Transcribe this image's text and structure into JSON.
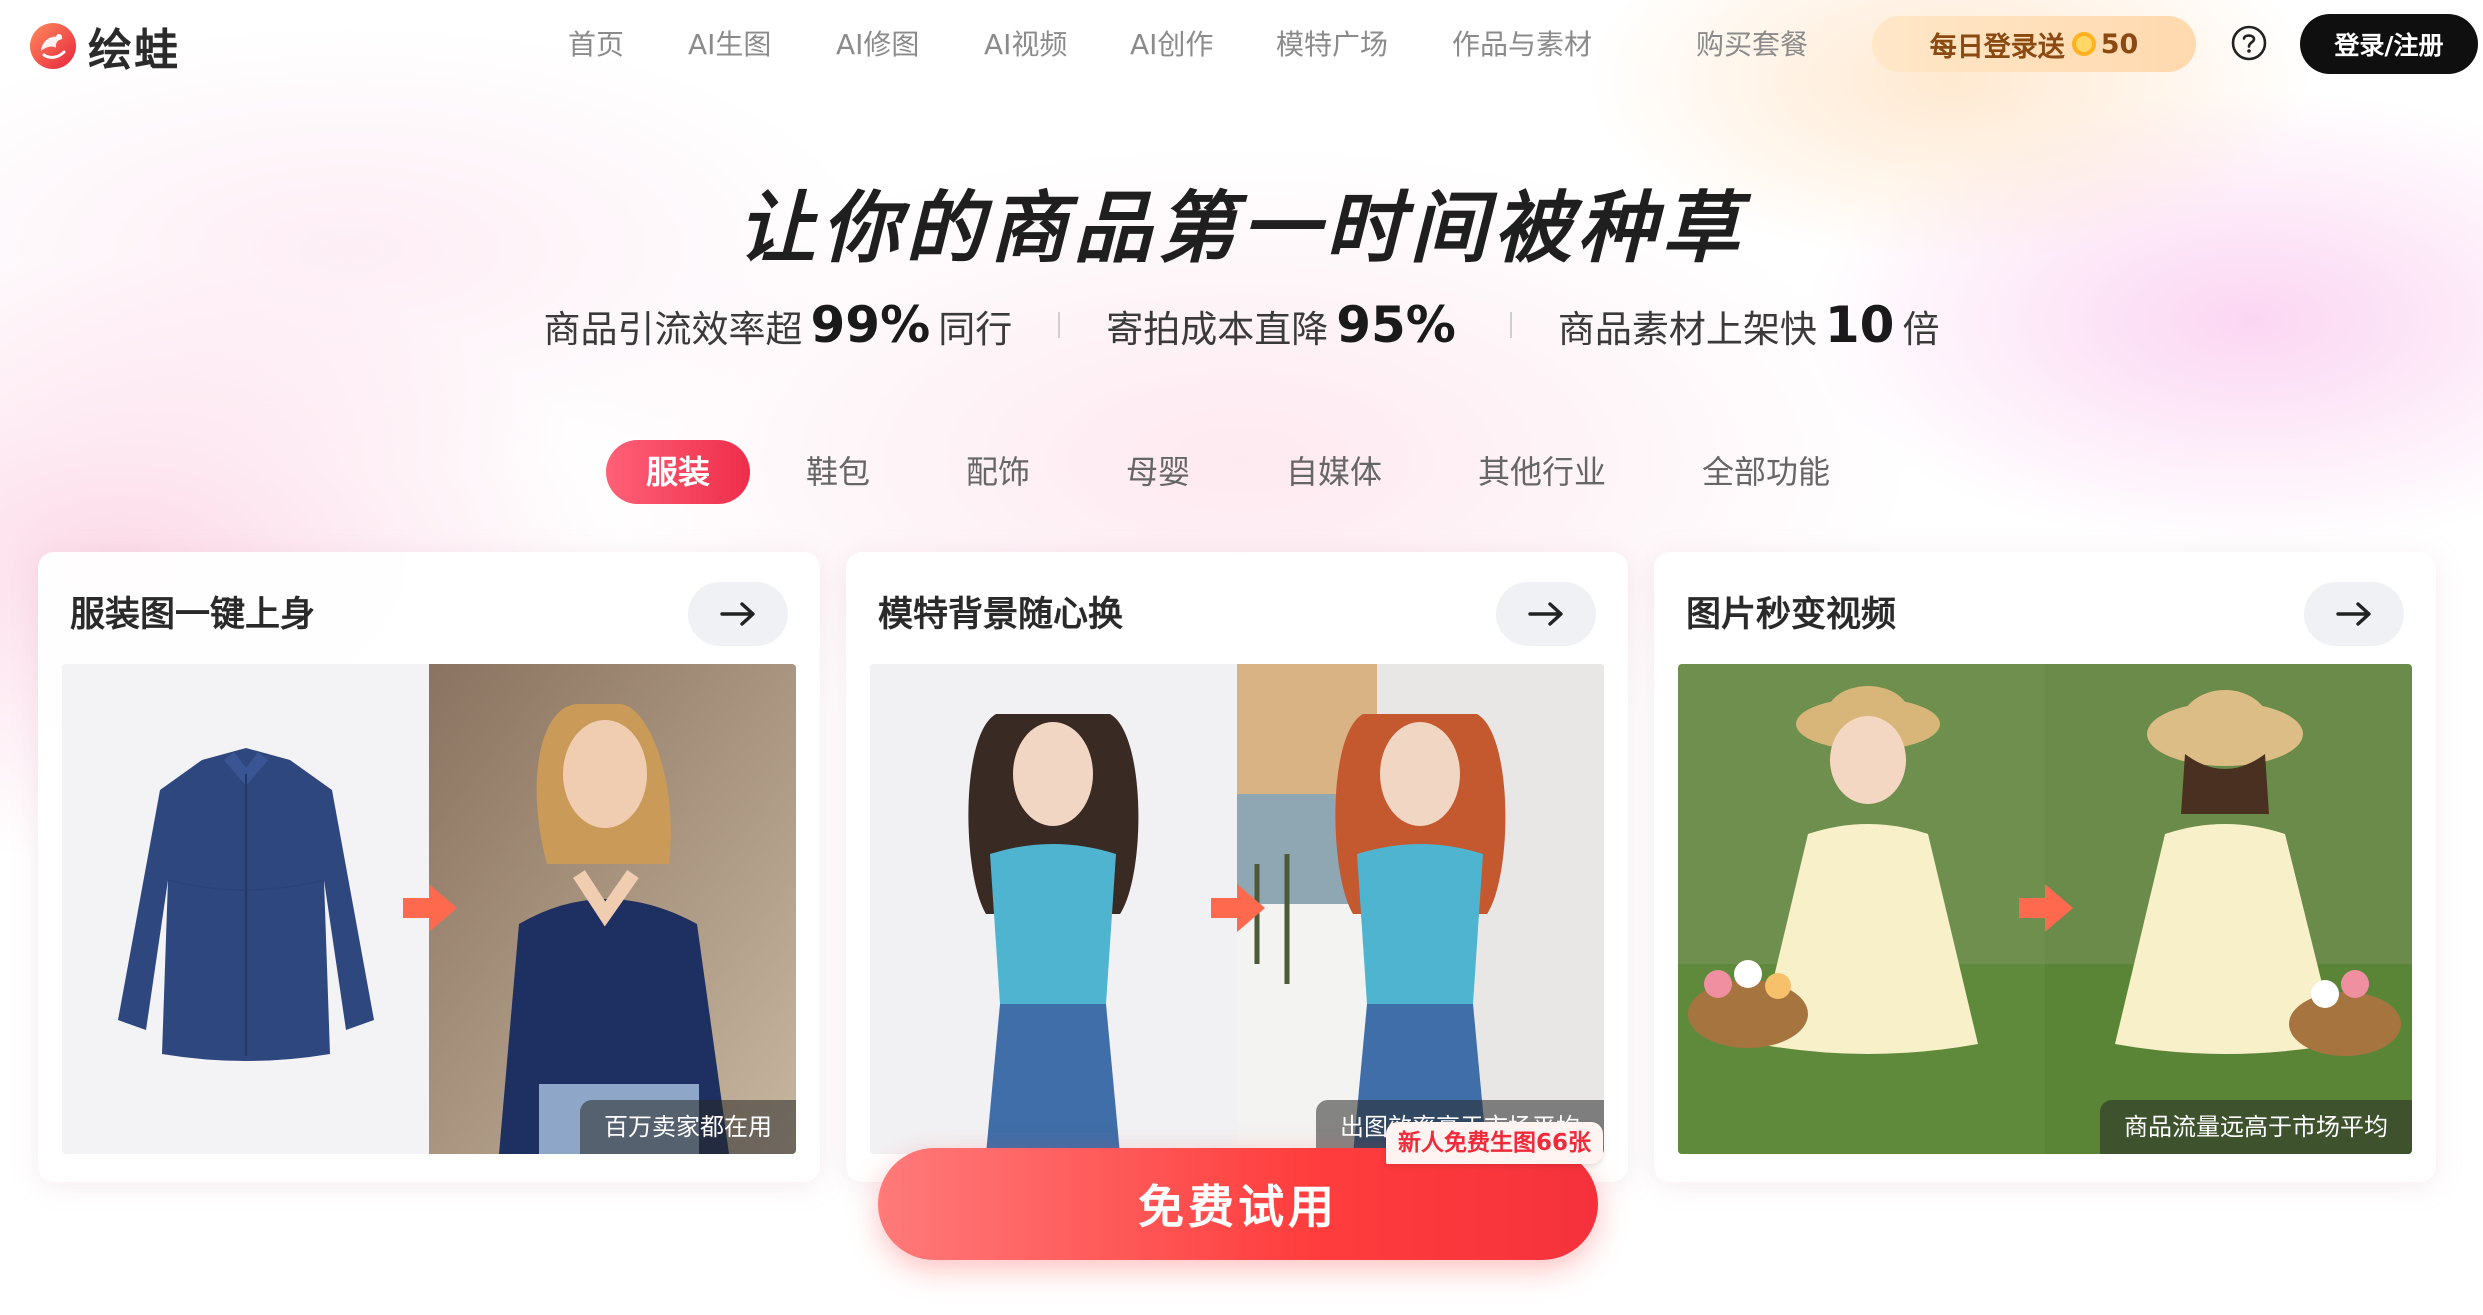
{
  "brand": {
    "name": "绘蛙",
    "logo_icon": "frog-logo-icon",
    "accent": "#ee2e4a"
  },
  "nav": {
    "items": [
      {
        "label": "首页"
      },
      {
        "label": "AI生图"
      },
      {
        "label": "AI修图"
      },
      {
        "label": "AI视频"
      },
      {
        "label": "AI创作"
      },
      {
        "label": "模特广场"
      },
      {
        "label": "作品与素材"
      },
      {
        "label": "购买套餐"
      }
    ],
    "promo": {
      "label": "每日登录送",
      "coin_icon": "coin-icon",
      "amount": "50"
    },
    "help_icon": "question-mark-icon",
    "login_label": "登录/注册"
  },
  "hero": {
    "title": "让你的商品第一时间被种草",
    "stats": [
      {
        "prefix": "商品引流效率超",
        "value": "99%",
        "suffix": "同行"
      },
      {
        "prefix": "寄拍成本直降",
        "value": "95%",
        "suffix": ""
      },
      {
        "prefix": "商品素材上架快",
        "value": "10",
        "suffix": "倍"
      }
    ]
  },
  "categories": {
    "active_index": 0,
    "items": [
      "服装",
      "鞋包",
      "配饰",
      "母婴",
      "自媒体",
      "其他行业",
      "全部功能"
    ]
  },
  "cards": [
    {
      "title": "服装图一键上身",
      "caption": "百万卖家都在用",
      "arrow_icon": "arrow-right-icon"
    },
    {
      "title": "模特背景随心换",
      "caption": "出图效率高于市场平均",
      "arrow_icon": "arrow-right-icon"
    },
    {
      "title": "图片秒变视频",
      "caption": "商品流量远高于市场平均",
      "arrow_icon": "arrow-right-icon"
    }
  ],
  "cta": {
    "label": "免费试用",
    "badge": "新人免费生图66张"
  }
}
